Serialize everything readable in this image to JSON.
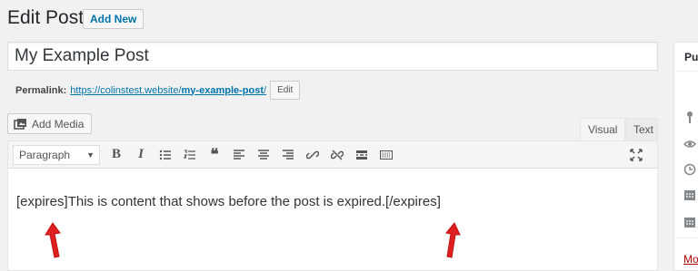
{
  "header": {
    "title": "Edit Post",
    "add_new_label": "Add New"
  },
  "post": {
    "title_value": "My Example Post"
  },
  "permalink": {
    "label": "Permalink:",
    "url_base": "https://colinstest.website/",
    "slug": "my-example-post",
    "url_end": "/",
    "edit_label": "Edit"
  },
  "media": {
    "add_media_label": "Add Media"
  },
  "editor_tabs": {
    "visual": "Visual",
    "text": "Text"
  },
  "toolbar": {
    "format_value": "Paragraph",
    "buttons": [
      "bold-icon",
      "italic-icon",
      "bulleted-list-icon",
      "numbered-list-icon",
      "blockquote-icon",
      "align-left-icon",
      "align-center-icon",
      "align-right-icon",
      "link-icon",
      "unlink-icon",
      "read-more-icon",
      "toolbar-toggle-icon",
      "fullscreen-icon"
    ]
  },
  "content": {
    "text": "[expires]This is content that shows before the post is expired.[/expires]"
  },
  "sidebar": {
    "heading": "Pu",
    "link": "Mo"
  },
  "colors": {
    "arrow": "#e02020",
    "link": "#0073aa"
  }
}
